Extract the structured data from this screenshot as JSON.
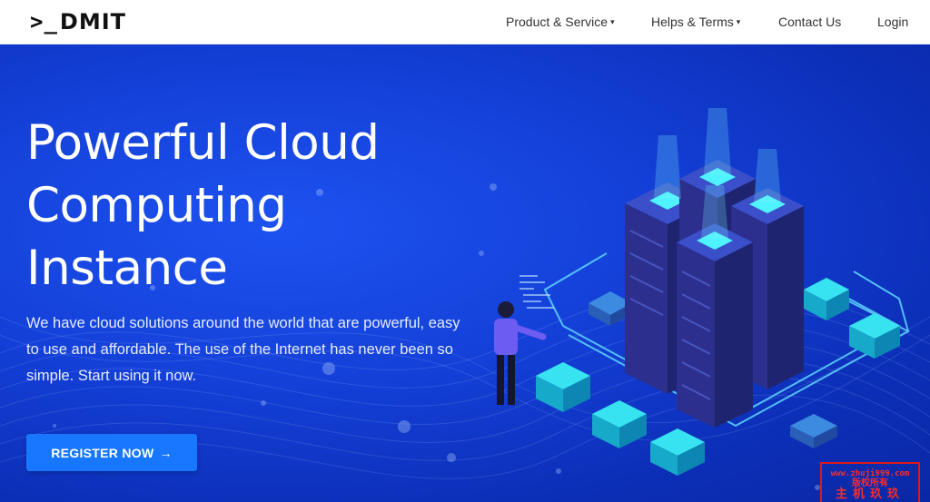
{
  "header": {
    "logo_prefix": ">_",
    "logo_text": "DMIT",
    "nav": {
      "product_service": "Product & Service",
      "helps_terms": "Helps & Terms",
      "contact_us": "Contact Us",
      "login": "Login"
    }
  },
  "hero": {
    "headline_line1": "Powerful Cloud",
    "headline_line2": "Computing",
    "headline_line3": "Instance",
    "description": "We have cloud solutions around the world that are powerful, easy to use and affordable. The use of the Internet has never been so simple. Start using it now.",
    "cta_label": "REGISTER NOW",
    "cta_arrow": "→"
  },
  "watermark": {
    "line1": "www.zhuji999.com",
    "line2": "版权所有",
    "line3": "主机玖玖"
  },
  "icons": {
    "dropdown": "chevron-down-icon",
    "cta": "arrow-right-icon"
  },
  "colors": {
    "hero_bg": "#1440d8",
    "cta_bg": "#1778ff",
    "nav_text": "#333333",
    "watermark": "#e01818"
  }
}
